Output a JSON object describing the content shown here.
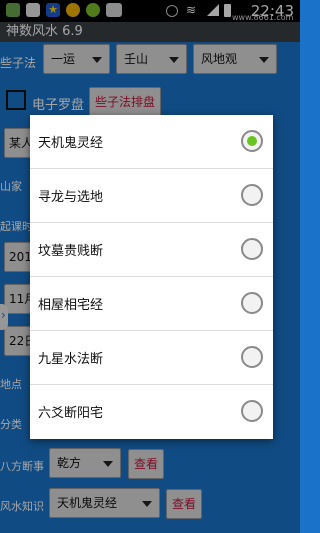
{
  "statusbar": {
    "time": "22:43",
    "site": "www.8661.com",
    "icons": [
      "photo-icon",
      "image-icon",
      "star-icon",
      "fan-icon",
      "app-icon",
      "sim-icon",
      "eye-icon",
      "wifi-icon",
      "signal-icon",
      "battery-icon"
    ]
  },
  "title": "神数风水 6.9",
  "form": {
    "row1_label": "些子法",
    "row1_opts": [
      "一运",
      "壬山",
      "风地观"
    ],
    "checkbox_label": "电子罗盘",
    "row2_button": "些子法排盘",
    "stub_btn": "某人",
    "label_shan": "山家",
    "label_qike": "起课时",
    "stub_201": "201",
    "stub_11": "11月",
    "stub_22": "22日",
    "label_didian": "地点",
    "label_fenlei": "分类",
    "row_bafang_label": "八方断事",
    "row_bafang_value": "乾方",
    "row_bafang_button": "查看",
    "row_fengshui_label": "风水知识",
    "row_fengshui_value": "天机鬼灵经",
    "row_fengshui_button": "查看"
  },
  "dialog": {
    "options": [
      {
        "label": "天机鬼灵经",
        "selected": true
      },
      {
        "label": "寻龙与选地",
        "selected": false
      },
      {
        "label": "坟墓贵贱断",
        "selected": false
      },
      {
        "label": "相屋相宅经",
        "selected": false
      },
      {
        "label": "九星水法断",
        "selected": false
      },
      {
        "label": "六爻断阳宅",
        "selected": false
      }
    ]
  },
  "colors": {
    "app_bg": "#1a73c9",
    "button_text": "#c0143c",
    "radio_on": "#69c420"
  }
}
